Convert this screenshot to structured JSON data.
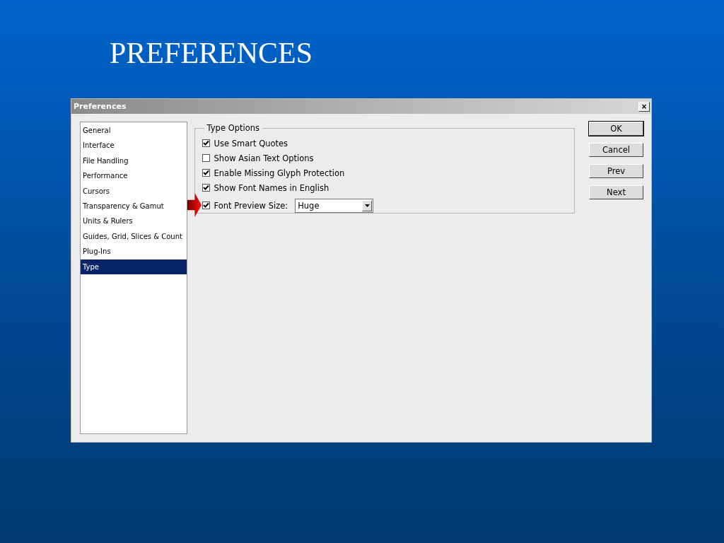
{
  "slide_title": "PREFERENCES",
  "window": {
    "title": "Preferences",
    "close": "×"
  },
  "sidebar": {
    "items": [
      {
        "label": "General",
        "selected": false
      },
      {
        "label": "Interface",
        "selected": false
      },
      {
        "label": "File Handling",
        "selected": false
      },
      {
        "label": "Performance",
        "selected": false
      },
      {
        "label": "Cursors",
        "selected": false
      },
      {
        "label": "Transparency & Gamut",
        "selected": false
      },
      {
        "label": "Units & Rulers",
        "selected": false
      },
      {
        "label": "Guides, Grid, Slices & Count",
        "selected": false
      },
      {
        "label": "Plug-Ins",
        "selected": false
      },
      {
        "label": "Type",
        "selected": true
      }
    ]
  },
  "group": {
    "title": "Type Options",
    "options": [
      {
        "kind": "checkbox",
        "label": "Use Smart Quotes",
        "checked": true
      },
      {
        "kind": "checkbox",
        "label": "Show Asian Text Options",
        "checked": false
      },
      {
        "kind": "checkbox",
        "label": "Enable Missing Glyph Protection",
        "checked": true
      },
      {
        "kind": "checkbox",
        "label": "Show Font Names in English",
        "checked": true
      },
      {
        "kind": "select",
        "label": "Font Preview Size:",
        "checked": true,
        "value": "Huge",
        "pointer": true
      }
    ]
  },
  "buttons": [
    "OK",
    "Cancel",
    "Prev",
    "Next"
  ]
}
